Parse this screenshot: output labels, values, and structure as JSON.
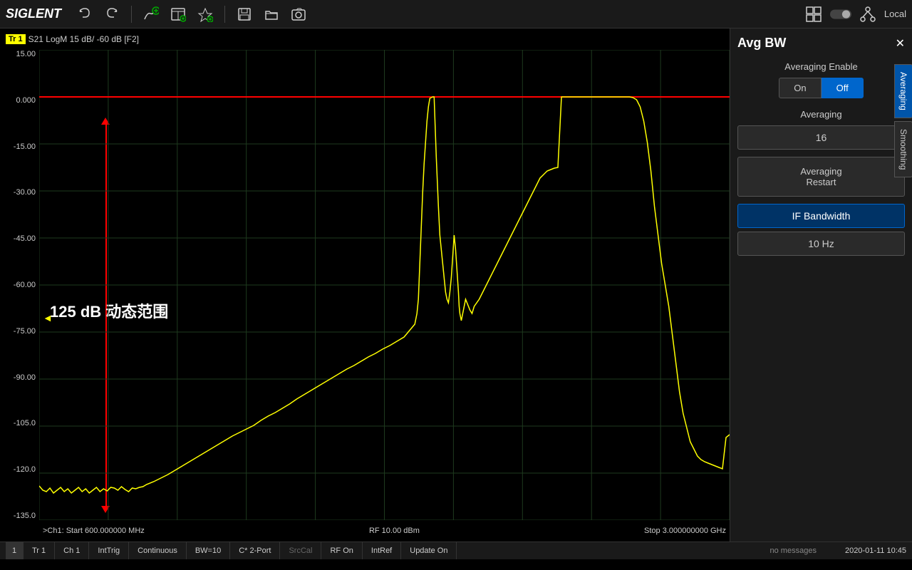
{
  "app": {
    "name": "SIGLENT",
    "local_label": "Local"
  },
  "toolbar": {
    "buttons": [
      "undo",
      "redo",
      "add-trace",
      "add-window",
      "add-marker",
      "save",
      "open",
      "screenshot"
    ]
  },
  "trace": {
    "label": "Tr 1",
    "info": "S21 LogM  15 dB/ -60 dB  [F2]"
  },
  "chart": {
    "y_labels": [
      "15.00",
      "0.000",
      "-15.00",
      "-30.00",
      "-45.00",
      "-60.00",
      "-75.00",
      "-90.00",
      "-105.0",
      "-120.0",
      "-135.0"
    ],
    "annotation": "125 dB 动态范围",
    "freq_start": ">Ch1: Start 600.000000 MHz",
    "freq_center": "RF 10.00 dBm",
    "freq_stop": "Stop 3.000000000 GHz"
  },
  "panel": {
    "title": "Avg BW",
    "tabs": [
      "Averaging",
      "Smoothing"
    ],
    "active_tab": "Averaging",
    "averaging_enable_label": "Averaging Enable",
    "on_label": "On",
    "off_label": "Off",
    "off_active": true,
    "averaging_label": "Averaging",
    "averaging_value": "16",
    "averaging_restart_label": "Averaging\nRestart",
    "if_bandwidth_label": "IF Bandwidth",
    "if_bandwidth_value": "10 Hz"
  },
  "status_bar": {
    "channel_num": "1",
    "trace": "Tr 1",
    "channel": "Ch 1",
    "trigger": "IntTrig",
    "sweep": "Continuous",
    "bw": "BW=10",
    "port": "C* 2-Port",
    "src_cal": "SrcCal",
    "rf": "RF On",
    "ref": "IntRef",
    "update": "Update On",
    "messages": "no messages",
    "datetime": "2020-01-11  10:45"
  }
}
